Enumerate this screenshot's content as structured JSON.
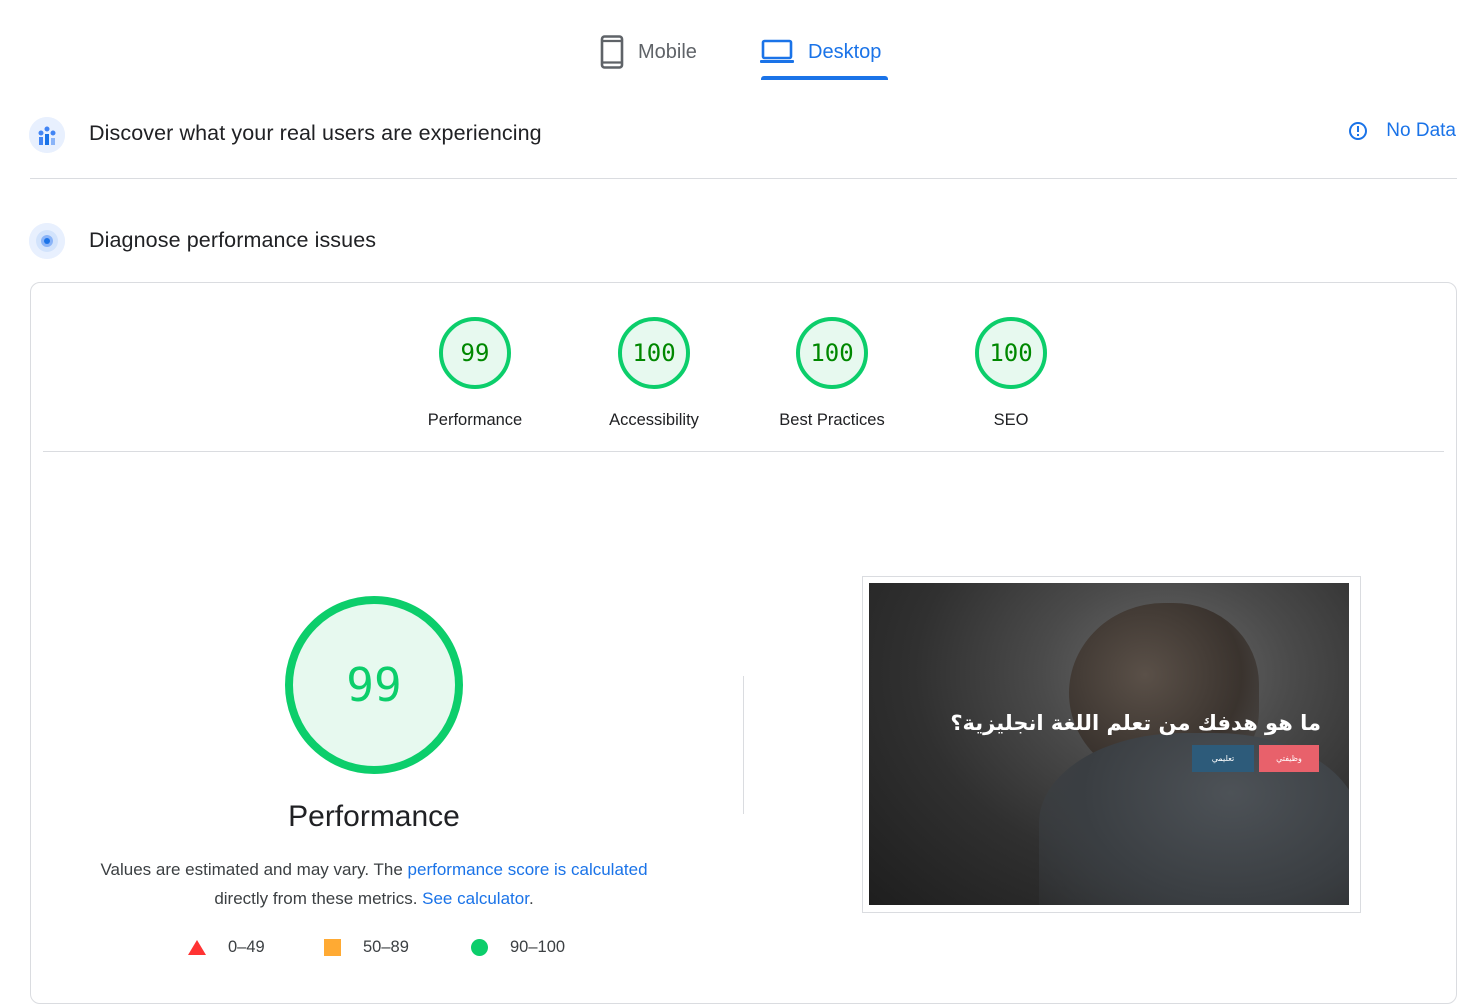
{
  "tabs": {
    "mobile_label": "Mobile",
    "desktop_label": "Desktop",
    "active": "desktop"
  },
  "field_section": {
    "title": "Discover what your real users are experiencing",
    "status": "No Data"
  },
  "lab_section": {
    "title": "Diagnose performance issues"
  },
  "scores": [
    {
      "label": "Performance",
      "value": "99"
    },
    {
      "label": "Accessibility",
      "value": "100"
    },
    {
      "label": "Best Practices",
      "value": "100"
    },
    {
      "label": "SEO",
      "value": "100"
    }
  ],
  "performance": {
    "score": "99",
    "title": "Performance",
    "desc_part1": "Values are estimated and may vary. The ",
    "desc_link1": "performance score is calculated",
    "desc_part2": " directly from these metrics. ",
    "desc_link2": "See calculator",
    "desc_end": "."
  },
  "legend": [
    {
      "range": "0–49",
      "color": "#ff3333"
    },
    {
      "range": "50–89",
      "color": "#ffaa33"
    },
    {
      "range": "90–100",
      "color": "#0cce6b"
    }
  ],
  "screenshot": {
    "headline": "ما هو هدفك من تعلم اللغة انجليزية؟",
    "btn_red": "وظيفتي",
    "btn_blue": "تعليمي"
  },
  "colors": {
    "accent": "#1a73e8",
    "pass": "#0cce6b",
    "average": "#ffaa33",
    "fail": "#ff3333"
  }
}
